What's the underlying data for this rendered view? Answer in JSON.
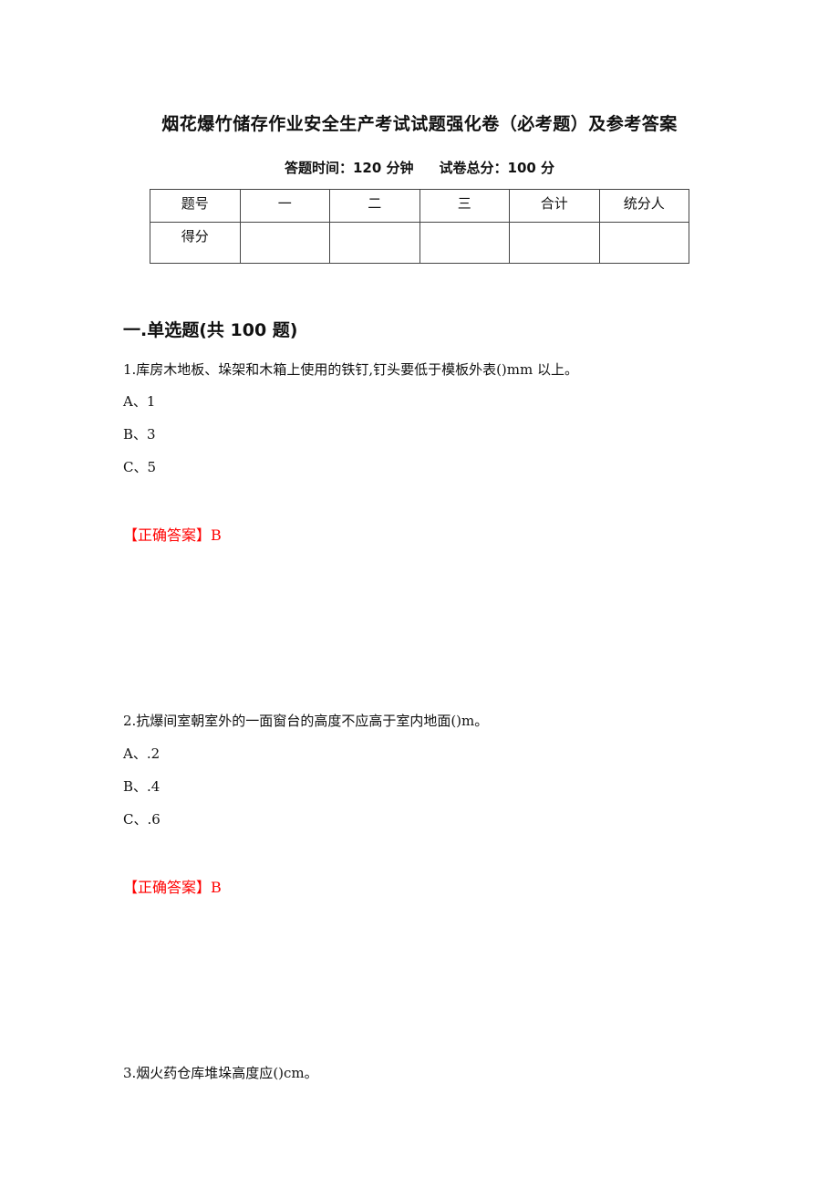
{
  "header": {
    "title": "烟花爆竹储存作业安全生产考试试题强化卷（必考题）及参考答案",
    "time_label": "答题时间：120 分钟",
    "score_label": "试卷总分：100 分"
  },
  "score_table": {
    "row1": [
      "题号",
      "一",
      "二",
      "三",
      "合计",
      "统分人"
    ],
    "row2": [
      "得分",
      "",
      "",
      "",
      "",
      ""
    ]
  },
  "section": {
    "heading": "一.单选题(共 100 题)"
  },
  "questions": [
    {
      "text": "1.库房木地板、垛架和木箱上使用的铁钉,钉头要低于模板外表()mm 以上。",
      "options": [
        "A、1",
        "B、3",
        "C、5"
      ],
      "answer_prefix": "【正确答案】",
      "answer": "B"
    },
    {
      "text": "2.抗爆间室朝室外的一面窗台的高度不应高于室内地面()m。",
      "options": [
        "A、.2",
        "B、.4",
        "C、.6"
      ],
      "answer_prefix": "【正确答案】",
      "answer": "B"
    },
    {
      "text": "3.烟火药仓库堆垛高度应()cm。"
    }
  ],
  "colors": {
    "answer": "#ff0000",
    "text": "#111111"
  }
}
